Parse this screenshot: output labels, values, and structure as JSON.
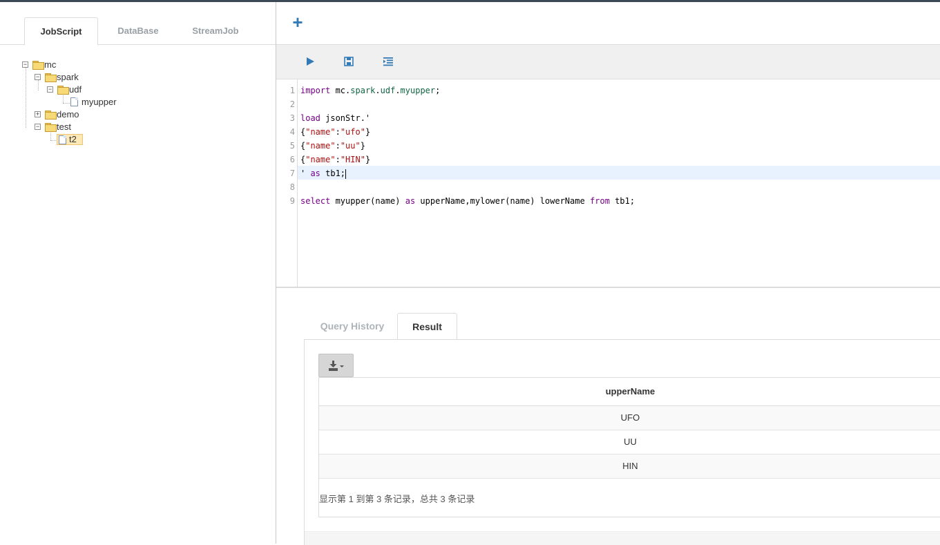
{
  "left_tabs": [
    "JobScript",
    "DataBase",
    "StreamJob"
  ],
  "tree": {
    "mc": "mc",
    "spark": "spark",
    "udf": "udf",
    "myupper": "myupper",
    "demo": "demo",
    "test": "test",
    "t2": "t2"
  },
  "toggles": {
    "expanded": "−",
    "collapsed": "+"
  },
  "toolbar": {
    "add_icon": "plus-icon",
    "run_icon": "play-icon",
    "save_icon": "save-icon",
    "format_icon": "indent-icon",
    "add_label": "+"
  },
  "editor": {
    "line_numbers": [
      "1",
      "2",
      "3",
      "4",
      "5",
      "6",
      "7",
      "8",
      "9"
    ],
    "lines": [
      "import mc.spark.udf.myupper;",
      "",
      "load jsonStr.'",
      "{\"name\":\"ufo\"}",
      "{\"name\":\"uu\"}",
      "{\"name\":\"HIN\"}",
      "' as tb1;",
      "",
      "select myupper(name) as upperName,mylower(name) lowerName from tb1;"
    ]
  },
  "result_tabs": [
    "Query History",
    "Result"
  ],
  "result": {
    "export_icon": "download-icon",
    "column": "upperName",
    "rows": [
      "UFO",
      "UU",
      "HIN"
    ],
    "pager_text": "显示第 1 到第 3 条记录，总共 3 条记录"
  },
  "colors": {
    "accent": "#337ab7",
    "selected_node": "#fde9b8",
    "active_line": "#e8f2ff"
  }
}
